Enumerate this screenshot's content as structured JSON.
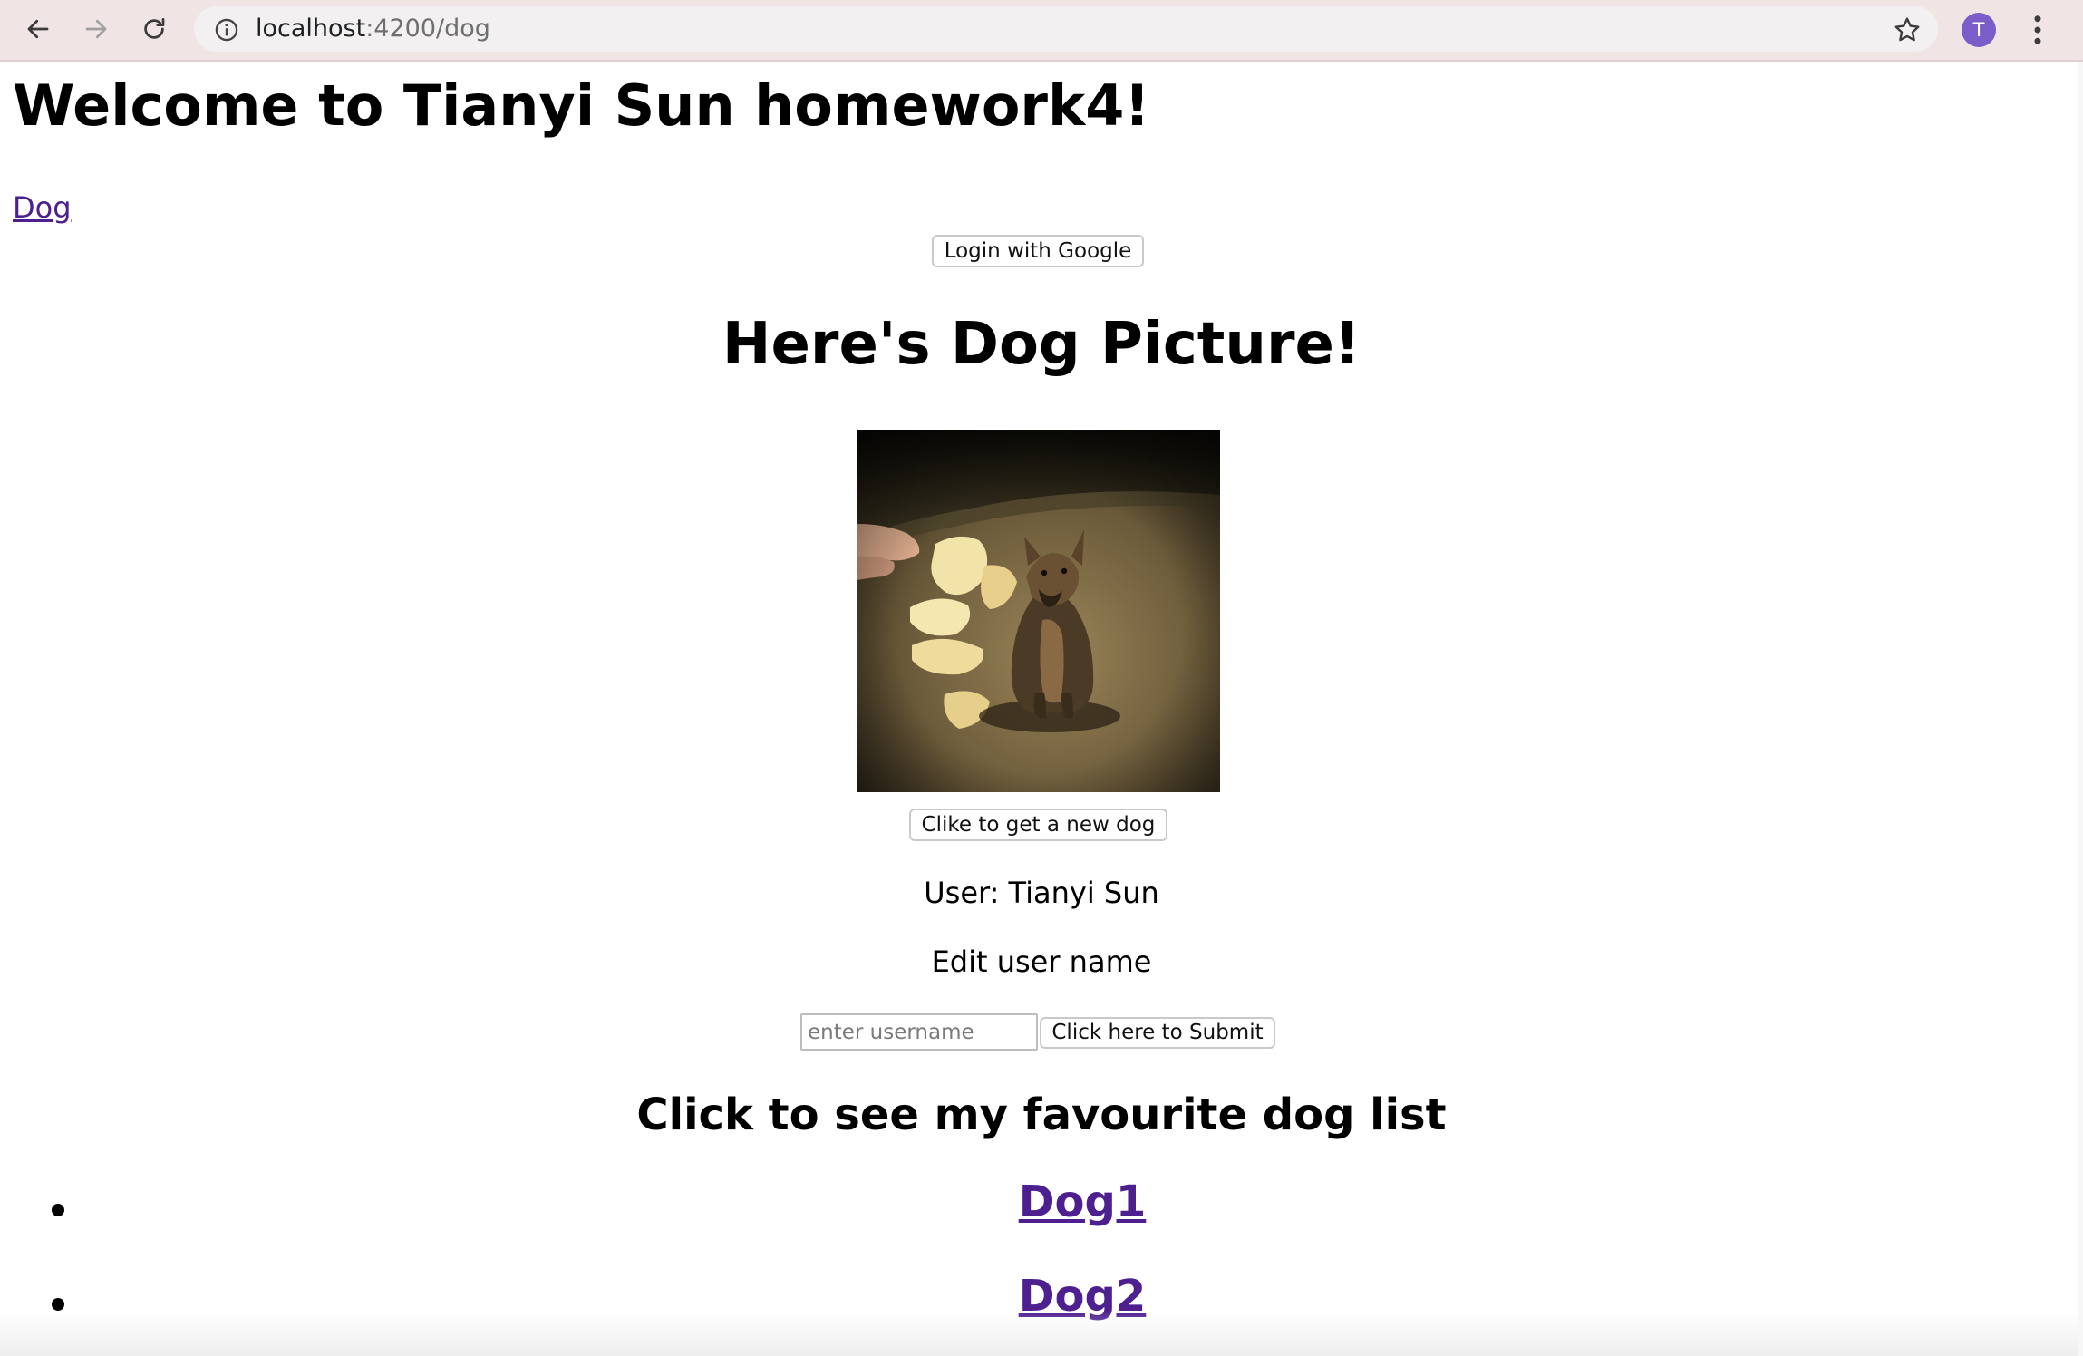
{
  "browser": {
    "url_host": "localhost",
    "url_rest": ":4200/dog",
    "profile_initial": "T"
  },
  "page": {
    "title": "Welcome to Tianyi Sun homework4!",
    "nav_link": "Dog",
    "login_button": "Login with Google",
    "picture_heading": "Here's Dog Picture!",
    "new_dog_button": "Clike to get a new dog",
    "user_label": "User: Tianyi Sun",
    "edit_label": "Edit user name",
    "username_placeholder": "enter username",
    "submit_button": "Click here to Submit",
    "favourites_heading": "Click to see my favourite dog list",
    "favourites": [
      "Dog1",
      "Dog2"
    ]
  },
  "colors": {
    "toolbar_bg": "#f1e4e4",
    "link": "#4d1f8f",
    "avatar": "#7b5cc8"
  },
  "icons": [
    "back-arrow-icon",
    "forward-arrow-icon",
    "reload-icon",
    "info-icon",
    "star-icon",
    "kebab-menu-icon"
  ]
}
